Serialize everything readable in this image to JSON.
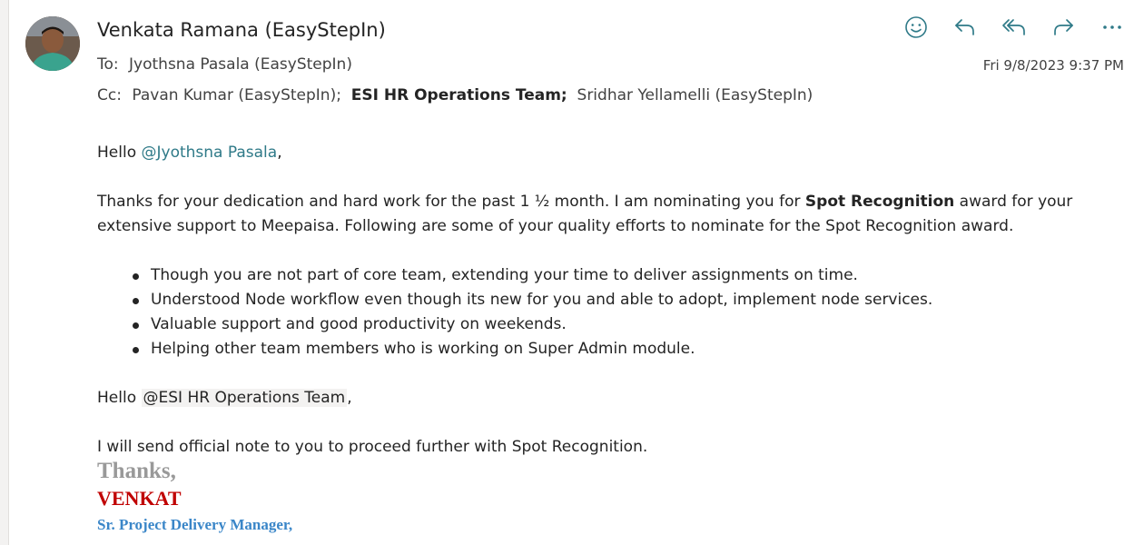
{
  "header": {
    "sender": "Venkata Ramana (EasyStepIn)",
    "to_label": "To:",
    "to_value": "Jyothsna Pasala (EasyStepIn)",
    "cc_label": "Cc:",
    "cc_1": "Pavan Kumar (EasyStepIn);",
    "cc_2": "ESI HR Operations Team;",
    "cc_3": "Sridhar Yellamelli (EasyStepIn)",
    "date": "Fri 9/8/2023 9:37 PM",
    "actions": [
      "smiley-icon",
      "reply-icon",
      "reply-all-icon",
      "forward-icon",
      "more-icon"
    ]
  },
  "body": {
    "greeting_1": "Hello ",
    "mention_1": "@Jyothsna Pasala",
    "greeting_1_end": ",",
    "para_1_start": "Thanks for your dedication and hard work for the past 1 ½ month. I am nominating you for ",
    "para_1_bold": "Spot Recognition",
    "para_1_end": " award for your extensive support to Meepaisa. Following are some of your quality efforts to nominate for the Spot Recognition award.",
    "bullets": [
      "Though you are not part of core team, extending your time to deliver assignments on time.",
      "Understood Node workflow even though its new for you and able to adopt, implement node services.",
      "Valuable support and good productivity on weekends.",
      "Helping other team members who is working on Super Admin module."
    ],
    "greeting_2": "Hello ",
    "mention_2": "@ESI HR Operations Team",
    "greeting_2_end": ",",
    "para_2": "I will send official note to you to proceed further with Spot Recognition."
  },
  "signature": {
    "thanks": "Thanks,",
    "name": "VENKAT",
    "title": "Sr. Project Delivery Manager,"
  },
  "colors": {
    "icon": "#2f7a88",
    "mention": "#2f7a88",
    "sig_name": "#c00000",
    "sig_title": "#3a86c8",
    "sig_thanks": "#999999"
  }
}
